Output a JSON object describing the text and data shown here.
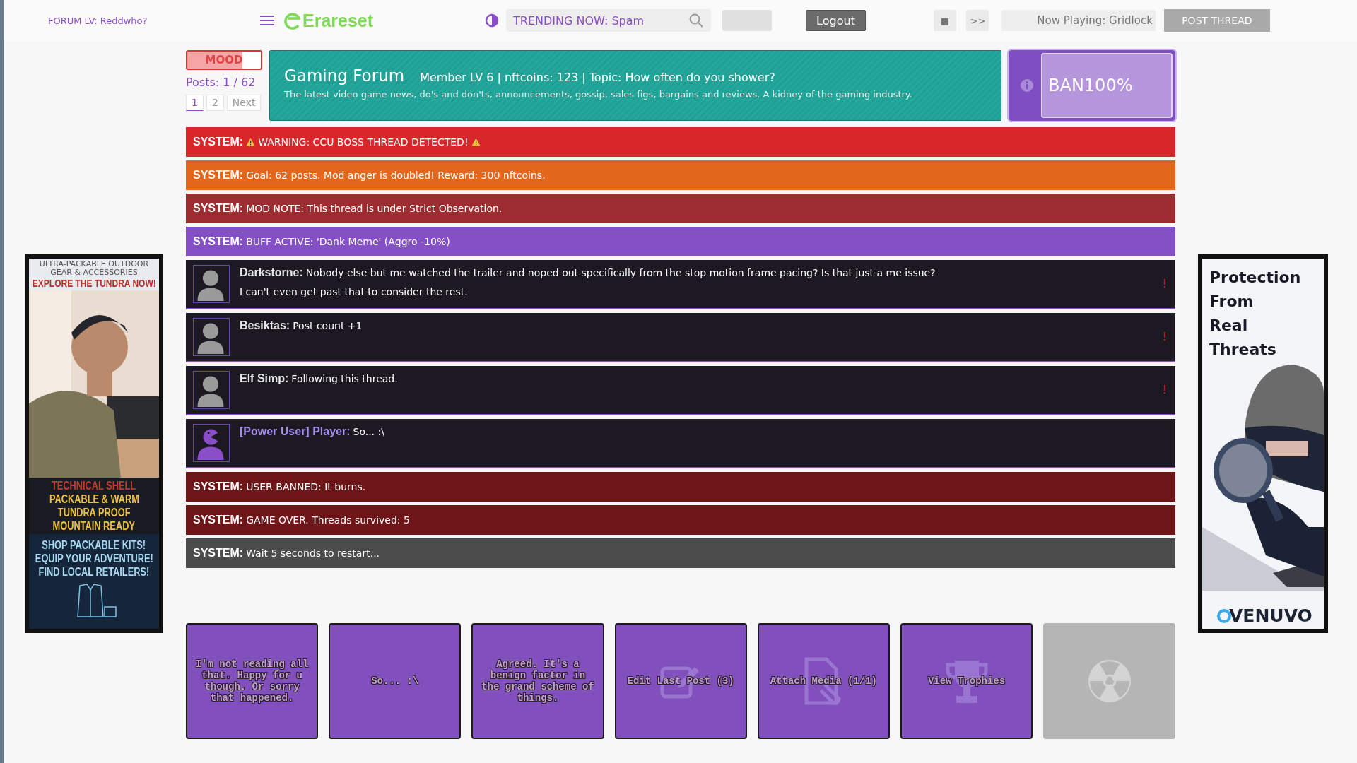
{
  "topbar": {
    "forum_level": "FORUM LV: Reddwho?",
    "logo": "Erareset",
    "search": {
      "value": "TRENDING NOW: Spam"
    },
    "logout": "Logout",
    "stop": "■",
    "skip": ">>",
    "now_playing": "Now Playing: Gridlock",
    "post_thread": {
      "label": "POST THREAD",
      "disabled": true
    }
  },
  "mood": {
    "label": "MOOD",
    "level": 0.75
  },
  "posts_count": "Posts: 1 / 62",
  "pagination": [
    {
      "label": "1",
      "selected": true
    },
    {
      "label": "2",
      "selected": false
    },
    {
      "label": "Next",
      "selected": false
    }
  ],
  "forum": {
    "title": "Gaming Forum",
    "meta": "Member LV 6 | nftcoins: 123 | Topic: How often do you shower?",
    "description": "The latest video game news, do's and don'ts, announcements, gossip, sales figs, bargains and reviews. A kidney of the gaming industry."
  },
  "ban": {
    "label": "BAN100%",
    "level": 1
  },
  "feed": [
    {
      "kind": "system",
      "label": "SYSTEM:",
      "text": "WARNING: CCU BOSS THREAD DETECTED!",
      "warning": true,
      "color": "#d9262b"
    },
    {
      "kind": "system",
      "label": "SYSTEM:",
      "text": "Goal: 62 posts. Mod anger is doubled! Reward: 300 nftcoins.",
      "warning": false,
      "color": "#e2661c"
    },
    {
      "kind": "system",
      "label": "SYSTEM:",
      "text": "MOD NOTE: This thread is under Strict Observation.",
      "warning": false,
      "color": "#9b2d30"
    },
    {
      "kind": "system",
      "label": "SYSTEM:",
      "text": "BUFF ACTIVE: 'Dank Meme' (Aggro -10%)",
      "warning": false,
      "color": "#8450c6"
    },
    {
      "kind": "post",
      "author": "Darkstorne:",
      "power_user": false,
      "lines": [
        "Nobody else but me watched the trailer and noped out specifically from the stop motion frame pacing? Is that just a me issue?",
        "I can't even get past that to consider the rest."
      ],
      "report": "!"
    },
    {
      "kind": "post",
      "author": "Besiktas:",
      "power_user": false,
      "lines": [
        "Post count +1"
      ],
      "report": "!"
    },
    {
      "kind": "post",
      "author": "Elf Simp:",
      "power_user": false,
      "lines": [
        "Following this thread."
      ],
      "report": "!"
    },
    {
      "kind": "post",
      "author": "[Power User] Player:",
      "power_user": true,
      "lines": [
        "So... :\\"
      ]
    },
    {
      "kind": "system",
      "label": "SYSTEM:",
      "text": "USER BANNED: It burns.",
      "warning": false,
      "color": "#6e1518"
    },
    {
      "kind": "system",
      "label": "SYSTEM:",
      "text": "GAME OVER. Threads survived: 5",
      "warning": false,
      "color": "#6e1518"
    },
    {
      "kind": "system",
      "label": "SYSTEM:",
      "text": "Wait 5 seconds to restart...",
      "warning": false,
      "color": "#4b4b4b"
    }
  ],
  "actions": [
    {
      "kind": "reply",
      "label": "I'm not reading all that. Happy for u though. Or sorry that happened.",
      "disabled": false
    },
    {
      "kind": "reply",
      "label": "So... :\\",
      "disabled": false
    },
    {
      "kind": "reply",
      "label": "Agreed. It's a benign factor in the grand scheme of things.",
      "disabled": false
    },
    {
      "kind": "edit",
      "label": "Edit Last Post (3)",
      "disabled": false
    },
    {
      "kind": "attach",
      "label": "Attach Media (1/1)",
      "disabled": false
    },
    {
      "kind": "trophy",
      "label": "View Trophies",
      "disabled": false
    },
    {
      "kind": "nuke",
      "disabled": true
    }
  ],
  "ad_left": {
    "top_lines": [
      "ULTRA-PACKABLE OUTDOOR",
      "GEAR & ACCESSORIES"
    ],
    "headline": "EXPLORE THE TUNDRA NOW!",
    "features": [
      "TECHNICAL SHELL",
      "PACKABLE & WARM",
      "TUNDRA PROOF",
      "MOUNTAIN READY"
    ],
    "calls": [
      "SHOP PACKABLE KITS!",
      "EQUIP YOUR ADVENTURE!",
      "FIND LOCAL RETAILERS!"
    ]
  },
  "ad_right": {
    "headline": [
      "Protection",
      "From",
      "Real",
      "Threats"
    ],
    "brand": "VENUVO"
  }
}
